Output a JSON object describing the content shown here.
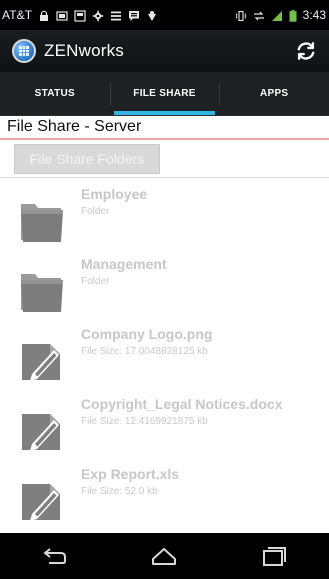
{
  "status_bar": {
    "carrier": "AT&T",
    "time": "3:43"
  },
  "header": {
    "app_title": "ZENworks"
  },
  "tabs": [
    {
      "label": "STATUS"
    },
    {
      "label": "FILE SHARE"
    },
    {
      "label": "APPS"
    }
  ],
  "page": {
    "title": "File Share - Server",
    "folders_button": "File Share Folders"
  },
  "files": [
    {
      "name": "Employee",
      "meta": "Folder",
      "icon": "folder-icon"
    },
    {
      "name": "Management",
      "meta": "Folder",
      "icon": "folder-icon"
    },
    {
      "name": "Company Logo.png",
      "meta": "File Size: 17.0048828125 kb",
      "icon": "document-icon"
    },
    {
      "name": "Copyright_Legal Notices.docx",
      "meta": "File Size: 12.4169921875 kb",
      "icon": "document-icon"
    },
    {
      "name": "Exp Report.xls",
      "meta": "File Size: 52.0 kb",
      "icon": "document-icon"
    }
  ]
}
